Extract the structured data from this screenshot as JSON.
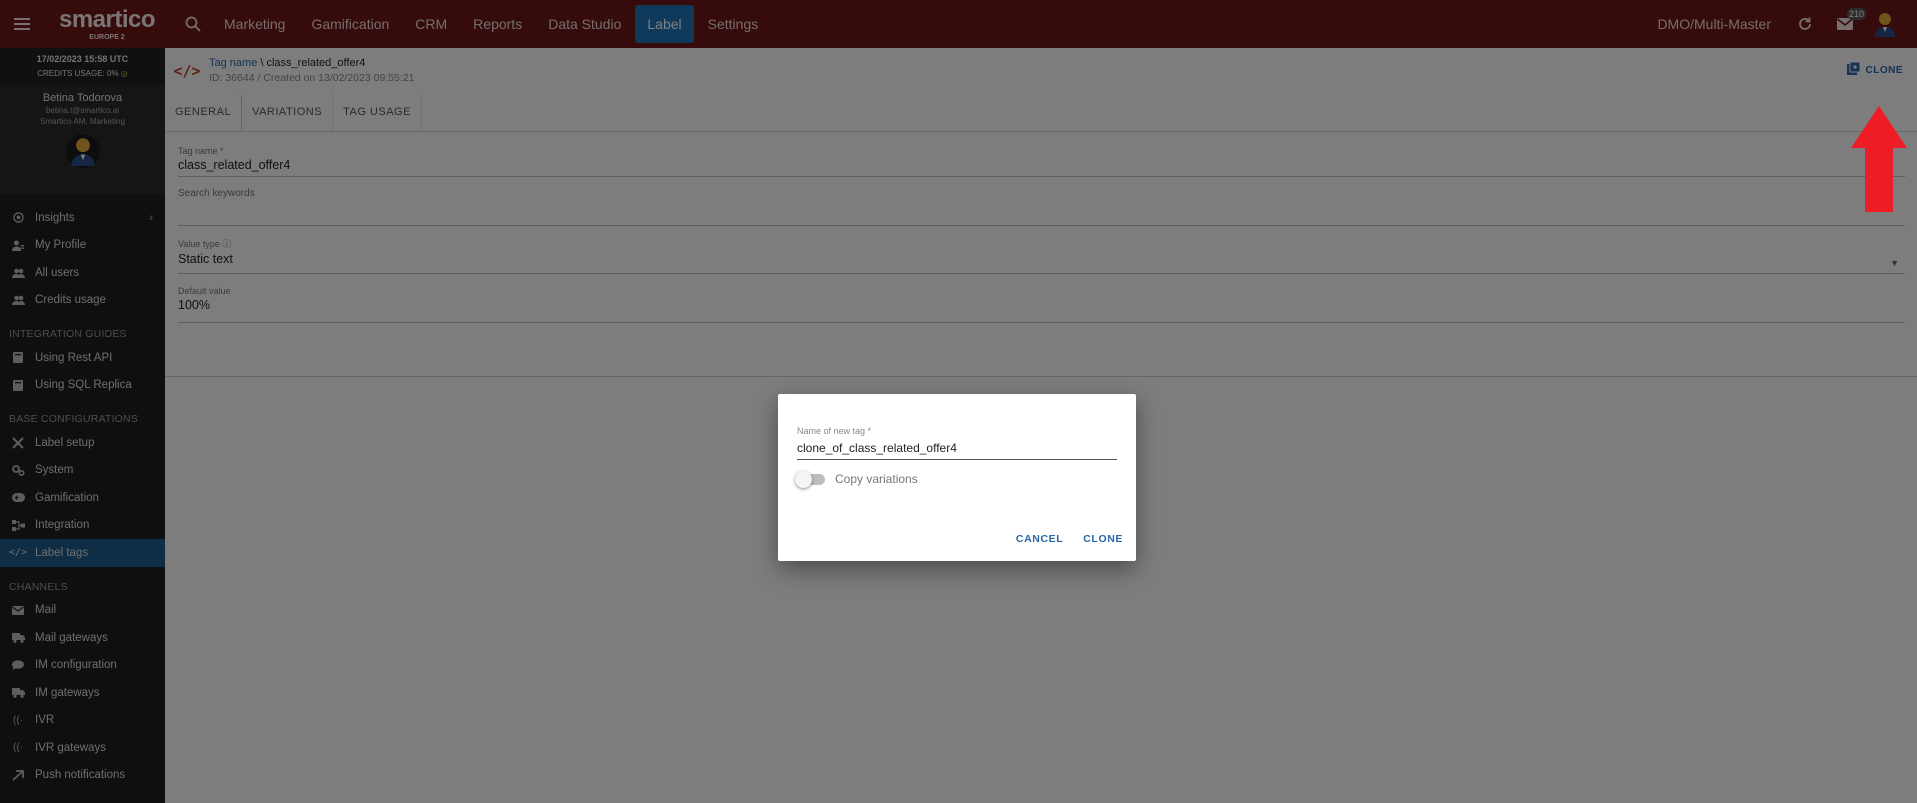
{
  "topbar": {
    "menu_icon": "hamburger-menu-icon",
    "logo": {
      "brand": "smartico",
      "region": "EUROPE 2"
    },
    "search_icon": "search-icon",
    "nav": [
      {
        "label": "Marketing"
      },
      {
        "label": "Gamification"
      },
      {
        "label": "CRM"
      },
      {
        "label": "Reports"
      },
      {
        "label": "Data Studio"
      },
      {
        "label": "Label",
        "active": true
      },
      {
        "label": "Settings"
      }
    ],
    "org": "DMO/Multi-Master",
    "mail_badge": "210",
    "colors": {
      "bar": "#6b1717",
      "active_nav": "#1e74b8"
    }
  },
  "sidebar": {
    "datetime": "17/02/2023 15:58 UTC",
    "credits": "CREDITS USAGE: 0%",
    "user": {
      "name": "Betina Todorova",
      "email": "betina.t@smartico.ai",
      "role": "Smartico AM, Marketing"
    },
    "items_top": [
      {
        "label": "Insights",
        "icon": "insights-icon",
        "has_children": true
      },
      {
        "label": "My Profile",
        "icon": "profile-icon"
      },
      {
        "label": "All users",
        "icon": "users-icon"
      },
      {
        "label": "Credits usage",
        "icon": "credits-icon"
      }
    ],
    "section_integration": "INTEGRATION GUIDES",
    "items_integration": [
      {
        "label": "Using Rest API",
        "icon": "book-icon"
      },
      {
        "label": "Using SQL Replica",
        "icon": "book-icon"
      }
    ],
    "section_base": "BASE CONFIGURATIONS",
    "items_base": [
      {
        "label": "Label setup",
        "icon": "tools-icon"
      },
      {
        "label": "System",
        "icon": "gears-icon"
      },
      {
        "label": "Gamification",
        "icon": "gamepad-icon"
      },
      {
        "label": "Integration",
        "icon": "integration-icon"
      },
      {
        "label": "Label tags",
        "icon": "code-icon",
        "active": true
      }
    ],
    "section_channels": "CHANNELS",
    "items_channels": [
      {
        "label": "Mail",
        "icon": "mail-icon"
      },
      {
        "label": "Mail gateways",
        "icon": "truck-icon"
      },
      {
        "label": "IM configuration",
        "icon": "chat-icon"
      },
      {
        "label": "IM gateways",
        "icon": "truck-icon"
      },
      {
        "label": "IVR",
        "icon": "ivr-icon"
      },
      {
        "label": "IVR gateways",
        "icon": "truck-icon"
      },
      {
        "label": "Push notifications",
        "icon": "push-icon"
      }
    ]
  },
  "main": {
    "breadcrumb_link": "Tag name",
    "breadcrumb_sep": " \\ ",
    "breadcrumb_current": "class_related_offer4",
    "meta": "ID: 36644 / Created on 13/02/2023 09:55:21",
    "clone_label": "CLONE",
    "tabs": [
      {
        "label": "GENERAL",
        "active": true
      },
      {
        "label": "VARIATIONS"
      },
      {
        "label": "TAG USAGE"
      }
    ],
    "fields": {
      "tag_name": {
        "label": "Tag name *",
        "value": "class_related_offer4"
      },
      "search_keywords": {
        "label": "Search keywords",
        "value": ""
      },
      "value_type": {
        "label": "Value type",
        "value": "Static text"
      },
      "default_value": {
        "label": "Default value",
        "value": "100%"
      }
    }
  },
  "dialog": {
    "name_label": "Name of new tag *",
    "name_value": "clone_of_class_related_offer4",
    "toggle_label": "Copy variations",
    "toggle_on": false,
    "cancel_label": "CANCEL",
    "confirm_label": "CLONE"
  },
  "annotation": {
    "arrow_color": "#ee1c24"
  }
}
